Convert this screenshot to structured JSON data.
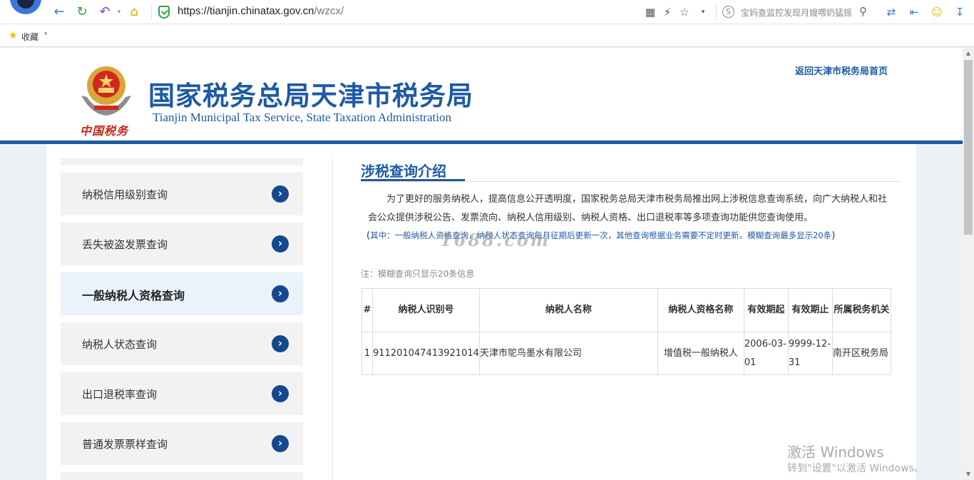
{
  "browser": {
    "url_host": "https://tianjin.chinatax.gov.cn",
    "url_path": "/wzcx/",
    "search_placeholder": "宝妈查监控发现月嫂喂奶猛摇"
  },
  "bookmarks": {
    "label": "收藏"
  },
  "header": {
    "seal_text": "中国税务",
    "title_cn": "国家税务总局天津市税务局",
    "title_en": "Tianjin Municipal Tax Service, State Taxation Administration",
    "return_link": "返回天津市税务局首页"
  },
  "sidebar": {
    "items": [
      {
        "label": "纳税信用级别查询"
      },
      {
        "label": "丢失被盗发票查询"
      },
      {
        "label": "一般纳税人资格查询"
      },
      {
        "label": "纳税人状态查询"
      },
      {
        "label": "出口退税率查询"
      },
      {
        "label": "普通发票票样查询"
      }
    ]
  },
  "main": {
    "section_title": "涉税查询介绍",
    "intro": "为了更好的服务纳税人，提高信息公开透明度，国家税务总局天津市税务局推出网上涉税信息查询系统，向广大纳税人和社会公众提供涉税公告、发票流向、纳税人信用级别、纳税人资格、出口退税率等多项查询功能供您查询使用。",
    "note_open": "(",
    "note": "其中：一般纳税人资格查询，纳税人状态查询每月征期后更新一次，其他查询根据业务需要不定时更新。模糊查询最多显示20条",
    "note_close": ")",
    "watermark": "1688.com",
    "fuzzy_note": "注：模糊查询只显示20条信息"
  },
  "table": {
    "headers": [
      "#",
      "纳税人识别号",
      "纳税人名称",
      "纳税人资格名称",
      "有效期起",
      "有效期止",
      "所属税务机关"
    ],
    "rows": [
      [
        "1",
        "911201047413921014",
        "天津市鸵鸟墨水有限公司",
        "增值税一般纳税人",
        "2006-03-01",
        "9999-12-31",
        "南开区税务局"
      ]
    ]
  },
  "os": {
    "activate_title": "激活 Windows",
    "activate_sub": "转到\"设置\"以激活 Windows。"
  }
}
